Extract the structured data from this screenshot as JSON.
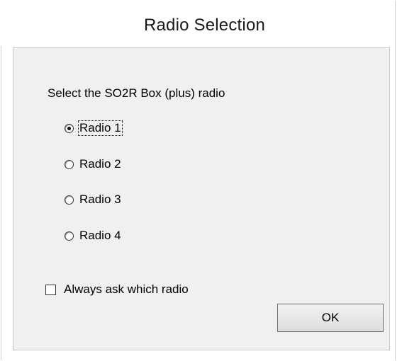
{
  "window": {
    "title": "Radio Selection"
  },
  "dialog": {
    "prompt": "Select the SO2R Box (plus) radio",
    "radios": [
      {
        "label": "Radio 1",
        "checked": true
      },
      {
        "label": "Radio 2",
        "checked": false
      },
      {
        "label": "Radio 3",
        "checked": false
      },
      {
        "label": "Radio 4",
        "checked": false
      }
    ],
    "always_ask_label": "Always ask which radio",
    "always_ask_checked": false,
    "ok_label": "OK"
  }
}
